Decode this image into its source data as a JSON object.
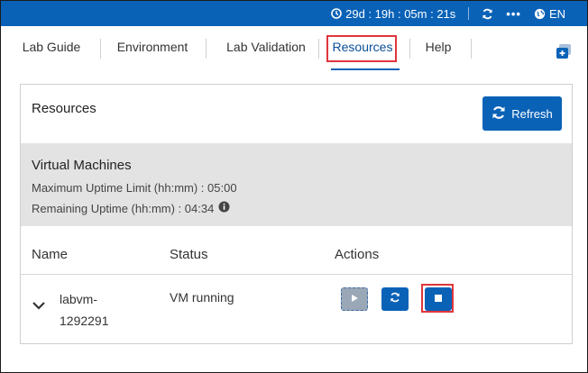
{
  "topbar": {
    "timer": "29d : 19h : 05m : 21s",
    "more": "•••",
    "language": "EN"
  },
  "tabs": [
    {
      "label": "Lab Guide"
    },
    {
      "label": "Environment"
    },
    {
      "label": "Lab Validation"
    },
    {
      "label": "Resources",
      "active": true
    },
    {
      "label": "Help"
    }
  ],
  "panel": {
    "title": "Resources",
    "refresh_label": "Refresh"
  },
  "vm_section": {
    "title": "Virtual Machines",
    "max_uptime": "Maximum Uptime Limit (hh:mm) : 05:00",
    "remaining_uptime": "Remaining Uptime (hh:mm) : 04:34"
  },
  "table": {
    "headers": [
      "Name",
      "Status",
      "Actions"
    ],
    "rows": [
      {
        "name_line1": "labvm-",
        "name_line2": "1292291",
        "status": "VM running"
      }
    ]
  },
  "colors": {
    "brand_blue": "#0a62b7",
    "highlight_red": "#e0353d",
    "section_gray": "#e3e3e3"
  }
}
